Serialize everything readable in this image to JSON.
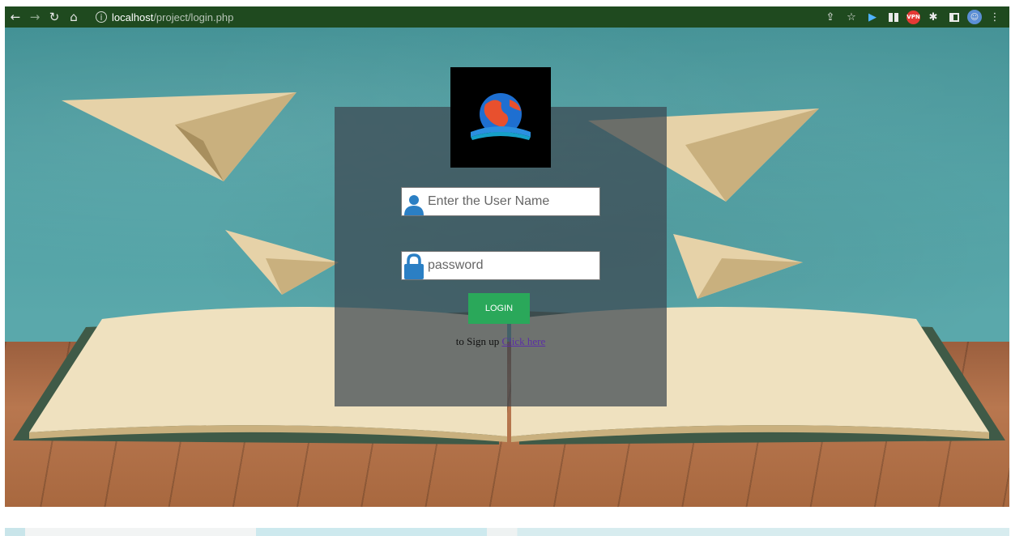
{
  "browser": {
    "url_host": "localhost",
    "url_path": "/project/login.php",
    "red_extension_label": "VPN"
  },
  "login": {
    "username_placeholder": "Enter the User Name",
    "password_placeholder": "password",
    "login_label": "LOGIN",
    "signup_text": "to Sign up",
    "signup_link": "Click here"
  },
  "colors": {
    "toolbar": "#1f4a1f",
    "panel": "#3c4650",
    "button": "#2aa85a",
    "link": "#5b2ea6",
    "icon": "#2b7fc4"
  },
  "icons": [
    "back-icon",
    "forward-icon",
    "reload-icon",
    "home-icon",
    "info-icon",
    "share-icon",
    "star-icon",
    "user-icon",
    "lock-icon",
    "globe-book-logo"
  ]
}
